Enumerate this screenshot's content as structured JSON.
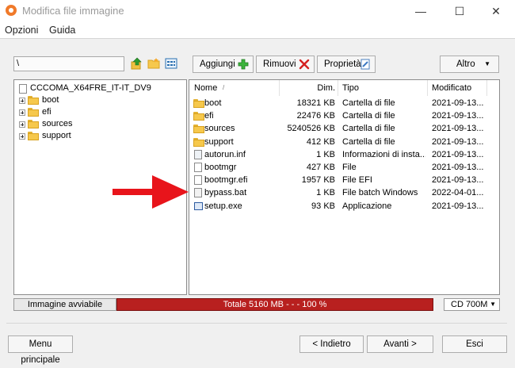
{
  "window": {
    "title": "Modifica file immagine",
    "controls": {
      "minimize": "—",
      "maximize": "☐",
      "close": "✕"
    }
  },
  "menu": {
    "items": [
      "Opzioni",
      "Guida"
    ]
  },
  "toolbar": {
    "path_value": "\\",
    "add_label": "Aggiungi",
    "remove_label": "Rimuovi",
    "properties_label": "Proprietà",
    "more_label": "Altro"
  },
  "tree": {
    "root": "CCCOMA_X64FRE_IT-IT_DV9",
    "items": [
      "boot",
      "efi",
      "sources",
      "support"
    ]
  },
  "files": {
    "columns": {
      "name": "Nome",
      "size": "Dim.",
      "type": "Tipo",
      "modified": "Modificato"
    },
    "rows": [
      {
        "name": "boot",
        "size": "18321 KB",
        "type": "Cartella di file",
        "modified": "2021-09-13...",
        "icon": "folder-icon"
      },
      {
        "name": "efi",
        "size": "22476 KB",
        "type": "Cartella di file",
        "modified": "2021-09-13...",
        "icon": "folder-icon"
      },
      {
        "name": "sources",
        "size": "5240526 KB",
        "type": "Cartella di file",
        "modified": "2021-09-13...",
        "icon": "folder-icon"
      },
      {
        "name": "support",
        "size": "412 KB",
        "type": "Cartella di file",
        "modified": "2021-09-13...",
        "icon": "folder-icon"
      },
      {
        "name": "autorun.inf",
        "size": "1 KB",
        "type": "Informazioni di insta...",
        "modified": "2021-09-13...",
        "icon": "settings-file-icon"
      },
      {
        "name": "bootmgr",
        "size": "427 KB",
        "type": "File",
        "modified": "2021-09-13...",
        "icon": "file-icon"
      },
      {
        "name": "bootmgr.efi",
        "size": "1957 KB",
        "type": "File EFI",
        "modified": "2021-09-13...",
        "icon": "file-icon"
      },
      {
        "name": "bypass.bat",
        "size": "1 KB",
        "type": "File batch Windows",
        "modified": "2022-04-01...",
        "icon": "batch-file-icon"
      },
      {
        "name": "setup.exe",
        "size": "93 KB",
        "type": "Applicazione",
        "modified": "2021-09-13...",
        "icon": "app-icon"
      }
    ]
  },
  "status": {
    "boot_label": "Immagine avviabile",
    "total_text": "Totale 5160 MB  - - -  100 %",
    "progress_percent": 100,
    "media_value": "CD 700M"
  },
  "footer": {
    "main_menu": "Menu principale",
    "back": "< Indietro",
    "next": "Avanti >",
    "exit": "Esci"
  },
  "colors": {
    "progress": "#b8201f",
    "arrow": "#e8141b",
    "folder": "#f6c84c"
  }
}
